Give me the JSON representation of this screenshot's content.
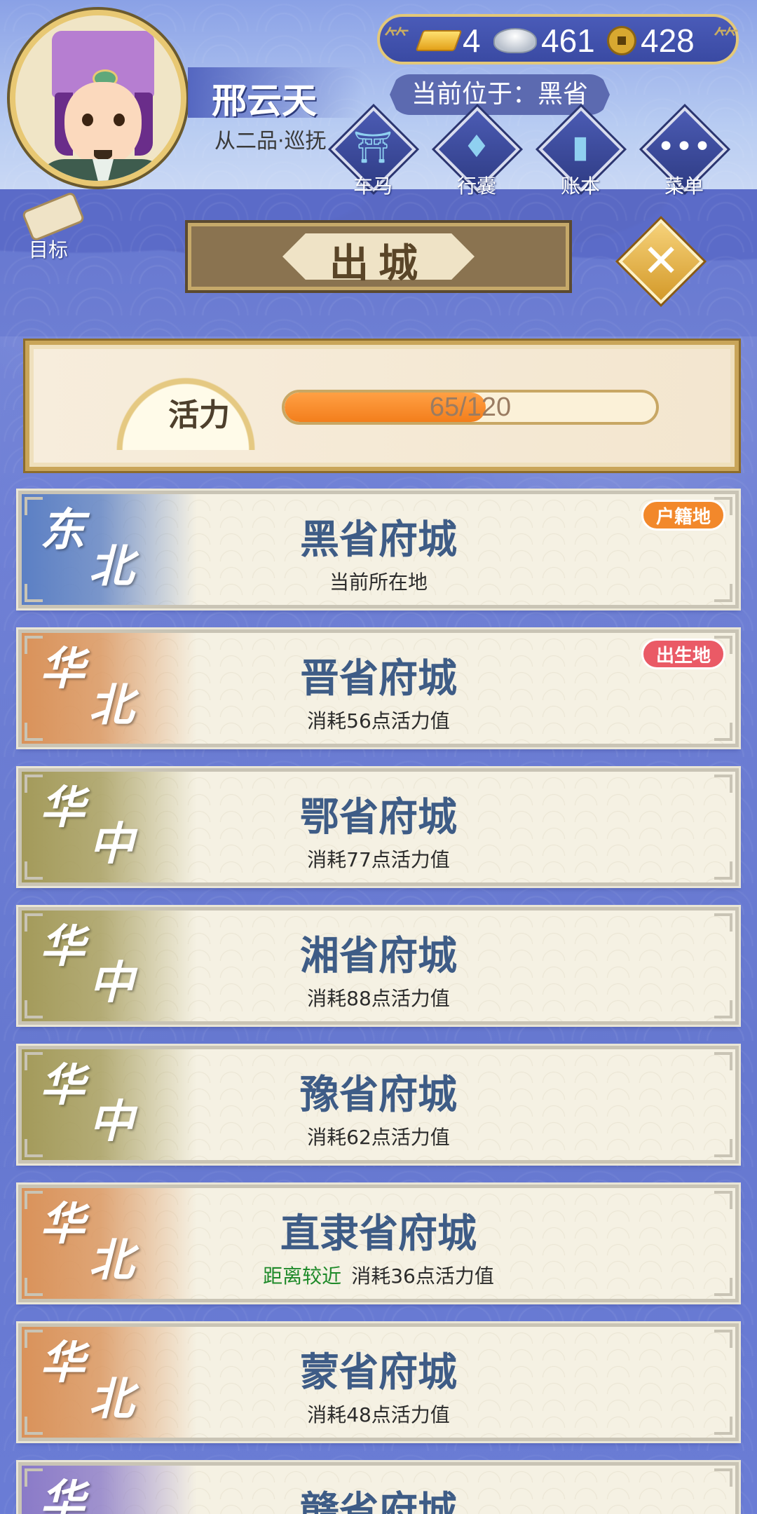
{
  "player": {
    "name": "邢云天",
    "title": "从二品·巡抚"
  },
  "currency": {
    "gold": "4",
    "silver": "461",
    "copper": "428"
  },
  "location": {
    "text": "当前位于：黑省"
  },
  "nav": {
    "carriage": "车马",
    "bag": "行囊",
    "ledger": "账本",
    "menu": "菜单",
    "goal": "目标"
  },
  "panel": {
    "title": "出城"
  },
  "stamina": {
    "label": "活力",
    "current": 65,
    "max": 120,
    "text": "65/120"
  },
  "colors": {
    "region_northeast": "#5b7fc4",
    "region_north": "#d9925a",
    "region_central": "#a39a5a",
    "badge_household": "#f2882b",
    "badge_birth": "#ea5a66"
  },
  "cities": [
    {
      "region1": "东",
      "region2": "北",
      "region_color": "#5b7fc4",
      "name": "黑省府城",
      "near": "",
      "sub": "当前所在地",
      "badge": "户籍地",
      "badge_color": "#f2882b"
    },
    {
      "region1": "华",
      "region2": "北",
      "region_color": "#d9925a",
      "name": "晋省府城",
      "near": "",
      "sub": "消耗56点活力值",
      "badge": "出生地",
      "badge_color": "#ea5a66"
    },
    {
      "region1": "华",
      "region2": "中",
      "region_color": "#a39a5a",
      "name": "鄂省府城",
      "near": "",
      "sub": "消耗77点活力值",
      "badge": "",
      "badge_color": ""
    },
    {
      "region1": "华",
      "region2": "中",
      "region_color": "#a39a5a",
      "name": "湘省府城",
      "near": "",
      "sub": "消耗88点活力值",
      "badge": "",
      "badge_color": ""
    },
    {
      "region1": "华",
      "region2": "中",
      "region_color": "#a39a5a",
      "name": "豫省府城",
      "near": "",
      "sub": "消耗62点活力值",
      "badge": "",
      "badge_color": ""
    },
    {
      "region1": "华",
      "region2": "北",
      "region_color": "#d9925a",
      "name": "直隶省府城",
      "near": "距离较近",
      "sub": "消耗36点活力值",
      "badge": "",
      "badge_color": ""
    },
    {
      "region1": "华",
      "region2": "北",
      "region_color": "#d9925a",
      "name": "蒙省府城",
      "near": "",
      "sub": "消耗48点活力值",
      "badge": "",
      "badge_color": ""
    },
    {
      "region1": "华",
      "region2": "",
      "region_color": "#8a7ac8",
      "name": "赣省府城",
      "near": "",
      "sub": "",
      "badge": "",
      "badge_color": ""
    }
  ]
}
